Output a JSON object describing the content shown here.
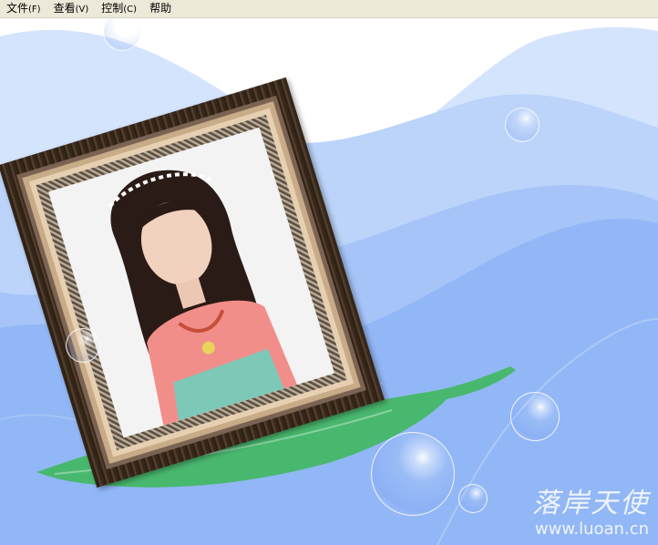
{
  "menubar": {
    "items": [
      {
        "label": "文件",
        "accel": "(F)"
      },
      {
        "label": "查看",
        "accel": "(V)"
      },
      {
        "label": "控制",
        "accel": "(C)"
      },
      {
        "label": "帮助",
        "accel": ""
      }
    ]
  },
  "watermark": {
    "title": "落岸天使",
    "url": "www.luoan.cn"
  },
  "colors": {
    "menubar_bg": "#ece9d8",
    "sky_light": "#d4e4fd",
    "wave_mid": "#b0cdf8",
    "wave_deep": "#8db4f7",
    "leaf": "#3fb85c"
  },
  "icons": [
    "photo-frame",
    "soap-bubble",
    "leaf"
  ]
}
